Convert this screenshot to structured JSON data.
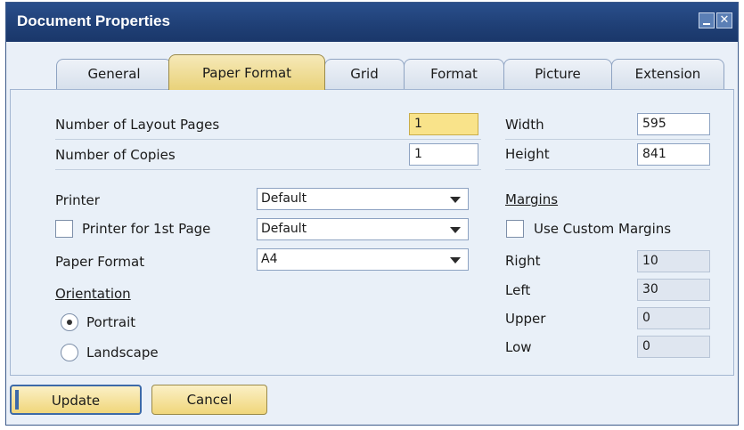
{
  "window": {
    "title": "Document Properties"
  },
  "tabs": [
    {
      "label": "General"
    },
    {
      "label": "Paper Format"
    },
    {
      "label": "Grid"
    },
    {
      "label": "Format"
    },
    {
      "label": "Picture"
    },
    {
      "label": "Extension"
    }
  ],
  "form": {
    "layout_pages_label": "Number of Layout Pages",
    "layout_pages_value": "1",
    "copies_label": "Number of Copies",
    "copies_value": "1",
    "printer_label": "Printer",
    "printer_value": "Default",
    "printer_first_label": "Printer for 1st Page",
    "printer_first_value": "Default",
    "paper_format_label": "Paper Format",
    "paper_format_value": "A4",
    "orientation_label": "Orientation",
    "portrait_label": "Portrait",
    "landscape_label": "Landscape",
    "orientation_selected": "Portrait",
    "width_label": "Width",
    "width_value": "595",
    "height_label": "Height",
    "height_value": "841",
    "margins_label": "Margins",
    "custom_margins_label": "Use Custom Margins",
    "right_label": "Right",
    "right_value": "10",
    "left_label": "Left",
    "left_value": "30",
    "upper_label": "Upper",
    "upper_value": "0",
    "low_label": "Low",
    "low_value": "0"
  },
  "buttons": {
    "update": "Update",
    "cancel": "Cancel"
  },
  "colors": {
    "title_bar": "#1f3f75",
    "active_tab": "#e9d27a",
    "highlight_field": "#f9e38a",
    "panel": "#e9f0f8"
  }
}
